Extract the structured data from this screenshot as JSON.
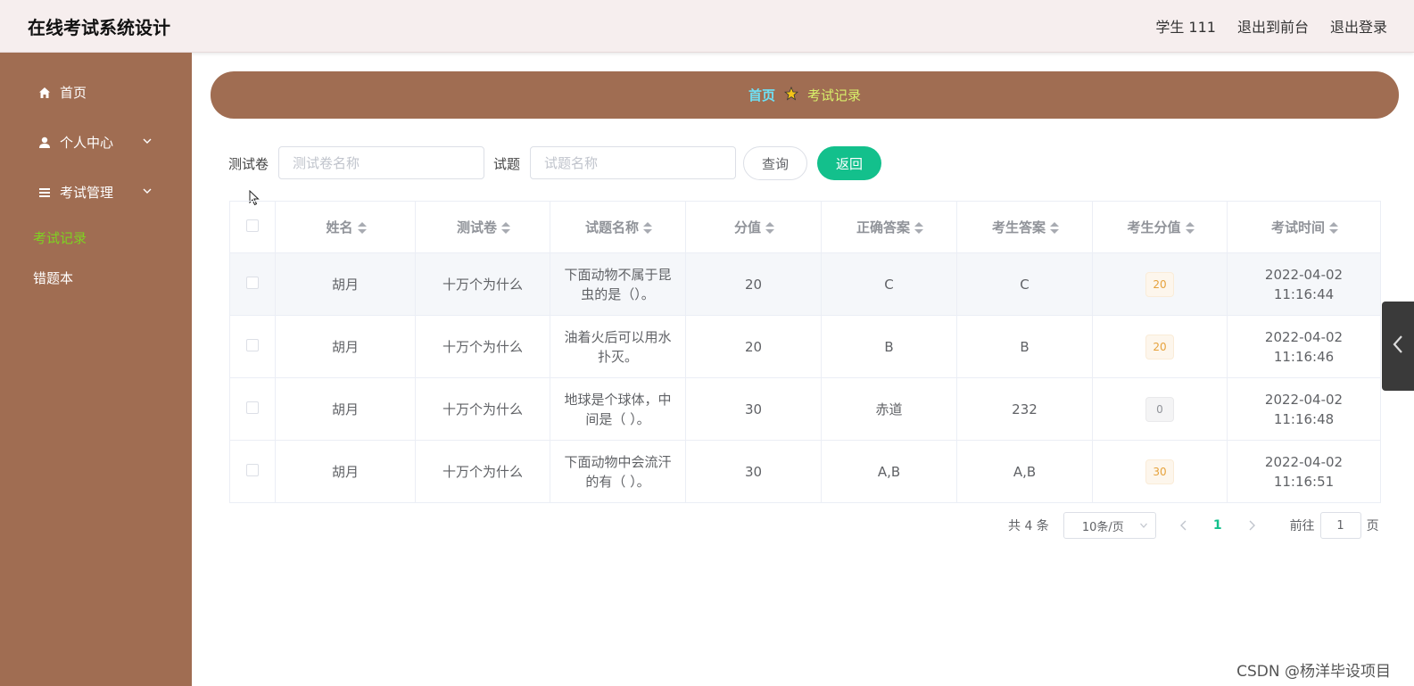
{
  "header": {
    "title": "在线考试系统设计",
    "links": [
      "学生 111",
      "退出到前台",
      "退出登录"
    ]
  },
  "sidebar": {
    "items": [
      {
        "label": "首页",
        "icon": "home-icon"
      },
      {
        "label": "个人中心",
        "icon": "user-icon"
      },
      {
        "label": "考试管理",
        "icon": "menu-icon"
      }
    ],
    "sub_items": [
      {
        "label": "考试记录",
        "active": true
      },
      {
        "label": "错题本",
        "active": false
      }
    ],
    "bg_color": "#a06d52",
    "active_color": "#7ed321"
  },
  "breadcrumb": {
    "home": "首页",
    "current": "考试记录"
  },
  "filters": {
    "paper_label": "测试卷",
    "paper_placeholder": "测试卷名称",
    "question_label": "试题",
    "question_placeholder": "试题名称",
    "query_button": "查询",
    "back_button": "返回"
  },
  "table": {
    "columns": [
      "姓名",
      "测试卷",
      "试题名称",
      "分值",
      "正确答案",
      "考生答案",
      "考生分值",
      "考试时间"
    ],
    "rows": [
      {
        "name": "胡月",
        "paper": "十万个为什么",
        "question": "下面动物不属于昆虫的是（）。",
        "points": "20",
        "correct": "C",
        "answer": "C",
        "score": "20",
        "time": "2022-04-02 11:16:44"
      },
      {
        "name": "胡月",
        "paper": "十万个为什么",
        "question": "油着火后可以用水扑灭。",
        "points": "20",
        "correct": "B",
        "answer": "B",
        "score": "20",
        "time": "2022-04-02 11:16:46"
      },
      {
        "name": "胡月",
        "paper": "十万个为什么",
        "question": "地球是个球体，中间是（ ）。",
        "points": "30",
        "correct": "赤道",
        "answer": "232",
        "score": "0",
        "time": "2022-04-02 11:16:48"
      },
      {
        "name": "胡月",
        "paper": "十万个为什么",
        "question": "下面动物中会流汗的有（ ）。",
        "points": "30",
        "correct": "A,B",
        "answer": "A,B",
        "score": "30",
        "time": "2022-04-02 11:16:51"
      }
    ]
  },
  "pagination": {
    "total": "共 4 条",
    "page_size": "10条/页",
    "current_page": "1",
    "goto_label": "前往",
    "goto_value": "1",
    "page_suffix": "页"
  },
  "accent_color": "#13c08c",
  "watermark": "CSDN @杨洋毕设项目"
}
